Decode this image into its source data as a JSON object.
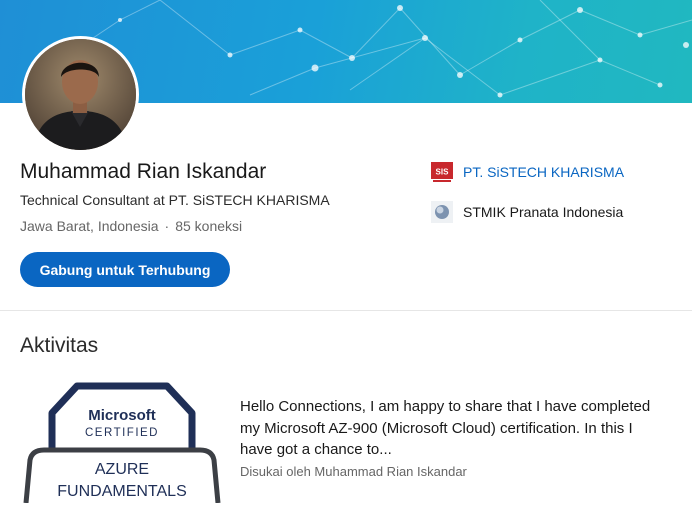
{
  "profile": {
    "name": "Muhammad Rian Iskandar",
    "headline": "Technical Consultant at PT. SiSTECH KHARISMA",
    "location": "Jawa Barat, Indonesia",
    "separator": "·",
    "connections": "85 koneksi",
    "cta_label": "Gabung untuk Terhubung"
  },
  "organizations": [
    {
      "name": "PT. SiSTECH KHARISMA",
      "logo_text": "SIS",
      "icon": "sistech-logo-icon"
    },
    {
      "name": "STMIK Pranata Indonesia",
      "icon": "stmik-logo-icon"
    }
  ],
  "activity": {
    "section_title": "Aktivitas",
    "badge": {
      "brand": "Microsoft",
      "certified": "CERTIFIED",
      "line1": "AZURE",
      "line2": "FUNDAMENTALS"
    },
    "post_text": "Hello Connections, I am happy to share that I have completed my Microsoft AZ-900 (Microsoft Cloud) certification. In this I have got a chance to...",
    "liked_by": "Disukai oleh Muhammad Rian Iskandar"
  },
  "colors": {
    "brand_blue": "#0a66c2",
    "banner_start": "#1f8fd6",
    "banner_end": "#20b8c0",
    "badge_navy": "#1f2f57"
  }
}
